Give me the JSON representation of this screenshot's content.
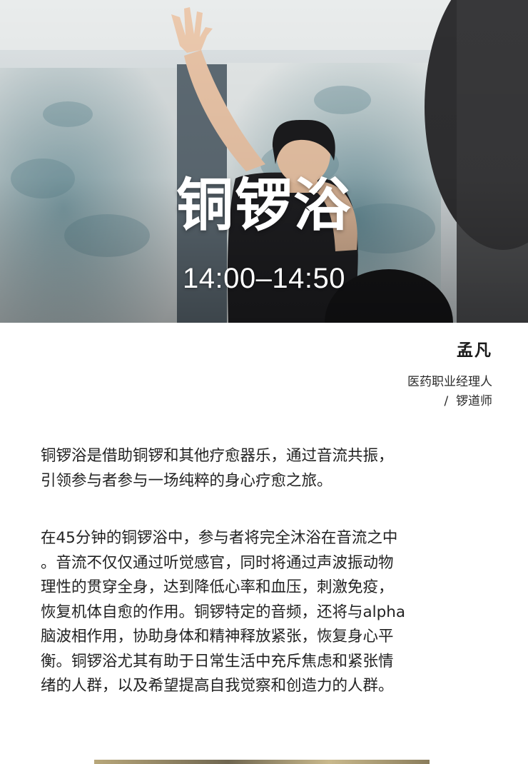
{
  "hero": {
    "title": "铜锣浴",
    "time": "14:00–14:50"
  },
  "presenter": {
    "name": "孟凡",
    "role_lines": [
      "医药职业经理人",
      "/  锣道师"
    ]
  },
  "paragraphs": [
    {
      "lines": [
        "铜锣浴是借助铜锣和其他疗愈器乐，通过音流共振，",
        "引领参与者参与一场纯粹的身心疗愈之旅。"
      ]
    },
    {
      "lines": [
        "在45分钟的铜锣浴中，参与者将完全沐浴在音流之中",
        "。音流不仅仅通过听觉感官，同时将通过声波振动物",
        "理性的贯穿全身，达到降低心率和血压，刺激免疫，",
        "恢复机体自愈的作用。铜锣特定的音频，还将与alpha",
        "脑波相作用，协助身体和精神释放紧张，恢复身心平",
        "衡。铜锣浴尤其有助于日常生活中充斥焦虑和紧张情",
        "绪的人群，以及希望提高自我觉察和创造力的人群。"
      ]
    }
  ]
}
